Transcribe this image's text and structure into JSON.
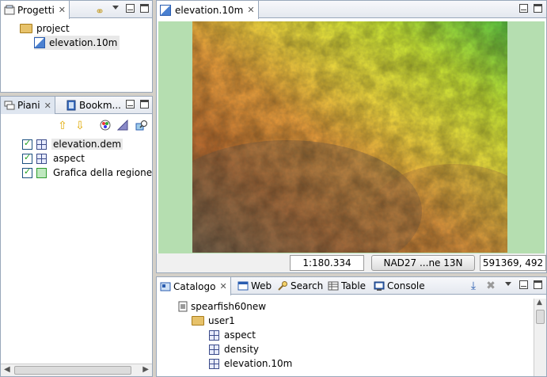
{
  "projects_panel": {
    "tab_label": "Progetti",
    "items": [
      {
        "label": "project"
      },
      {
        "label": "elevation.10m"
      }
    ]
  },
  "layers_panel": {
    "tabs": [
      {
        "label": "Piani"
      },
      {
        "label": "Bookm..."
      }
    ],
    "layers": [
      {
        "label": "elevation.dem",
        "checked": true,
        "type": "raster"
      },
      {
        "label": "aspect",
        "checked": true,
        "type": "raster"
      },
      {
        "label": "Grafica della regione att",
        "checked": true,
        "type": "vector"
      }
    ]
  },
  "map_editor": {
    "tab_label": "elevation.10m",
    "scale": "1:180.334",
    "crs": "NAD27 ...ne 13N",
    "coordinates": "591369, 492"
  },
  "bottom_panel": {
    "tabs": [
      {
        "label": "Catalogo"
      },
      {
        "label": "Web"
      },
      {
        "label": "Search"
      },
      {
        "label": "Table"
      },
      {
        "label": "Console"
      }
    ],
    "catalog_tree": [
      {
        "label": "spearfish60new"
      },
      {
        "label": "user1"
      },
      {
        "label": "aspect"
      },
      {
        "label": "density"
      },
      {
        "label": "elevation.10m"
      }
    ]
  },
  "colors": {
    "panel_border": "#99a8bb",
    "map_margin_green": "#b5deb0",
    "selection_bg": "#e8e8e8"
  }
}
